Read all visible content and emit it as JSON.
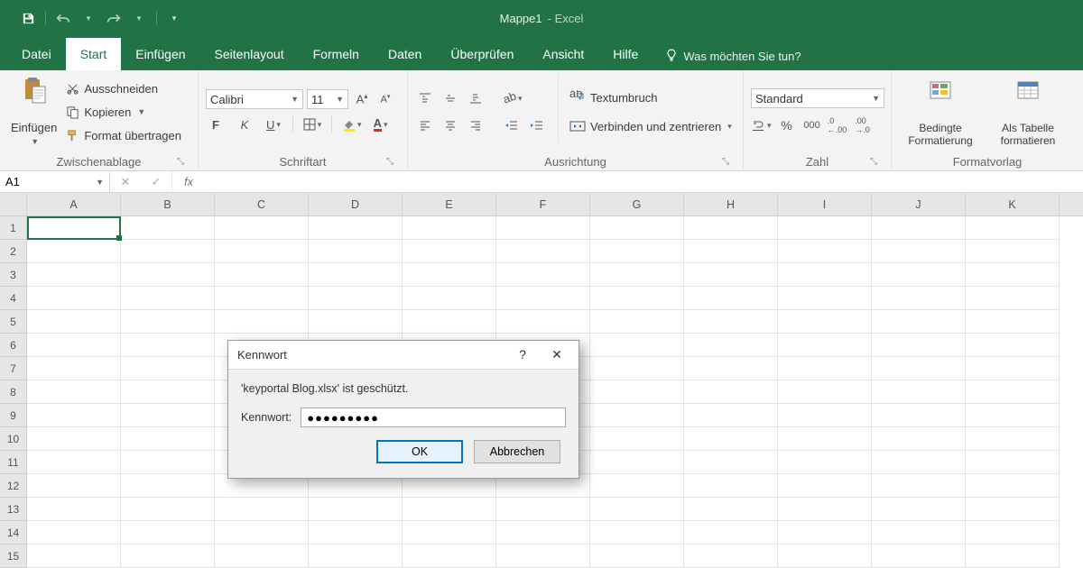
{
  "title": {
    "document": "Mappe1",
    "app_suffix": "-  Excel"
  },
  "tabs": [
    "Datei",
    "Start",
    "Einfügen",
    "Seitenlayout",
    "Formeln",
    "Daten",
    "Überprüfen",
    "Ansicht",
    "Hilfe"
  ],
  "active_tab": "Start",
  "tell_me": "Was möchten Sie tun?",
  "clipboard": {
    "paste": "Einfügen",
    "cut": "Ausschneiden",
    "copy": "Kopieren",
    "format_painter": "Format übertragen",
    "group": "Zwischenablage"
  },
  "font": {
    "name": "Calibri",
    "size": "11",
    "bold": "F",
    "italic": "K",
    "underline": "U",
    "group": "Schriftart"
  },
  "alignment": {
    "wrap": "Textumbruch",
    "merge": "Verbinden und zentrieren",
    "group": "Ausrichtung"
  },
  "number": {
    "format": "Standard",
    "group": "Zahl"
  },
  "styles": {
    "conditional": "Bedingte\nFormatierung",
    "as_table": "Als Tabelle\nformatieren",
    "group": "Formatvorlag"
  },
  "namebox": "A1",
  "columns": [
    "A",
    "B",
    "C",
    "D",
    "E",
    "F",
    "G",
    "H",
    "I",
    "J",
    "K"
  ],
  "rows": [
    "1",
    "2",
    "3",
    "4",
    "5",
    "6",
    "7",
    "8",
    "9",
    "10",
    "11",
    "12",
    "13",
    "14",
    "15"
  ],
  "dialog": {
    "title": "Kennwort",
    "message": "'keyportal Blog.xlsx' ist geschützt.",
    "label": "Kennwort:",
    "value": "●●●●●●●●●",
    "ok": "OK",
    "cancel": "Abbrechen"
  }
}
